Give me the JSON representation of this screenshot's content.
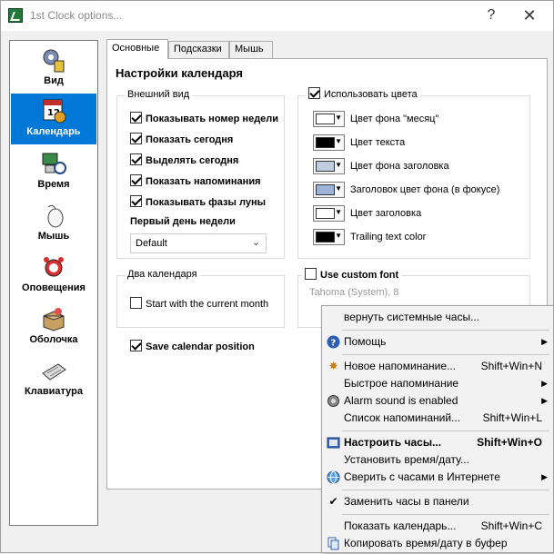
{
  "window": {
    "title": "1st Clock options...",
    "help_glyph": "?",
    "close_glyph": "✕"
  },
  "sidebar": {
    "items": [
      {
        "label": "Вид",
        "icon": "gear-icon"
      },
      {
        "label": "Календарь",
        "icon": "calendar-icon"
      },
      {
        "label": "Время",
        "icon": "computer-clock-icon"
      },
      {
        "label": "Мышь",
        "icon": "mouse-icon"
      },
      {
        "label": "Оповещения",
        "icon": "alarm-clock-icon"
      },
      {
        "label": "Оболочка",
        "icon": "box-icon"
      },
      {
        "label": "Клавиатура",
        "icon": "keyboard-icon"
      }
    ],
    "active_index": 1
  },
  "tabs": [
    {
      "label": "Основные",
      "active": true
    },
    {
      "label": "Подсказки",
      "active": false
    },
    {
      "label": "Мышь",
      "active": false
    }
  ],
  "panel": {
    "title": "Настройки календаря",
    "appearance": {
      "legend": "Внешний вид",
      "checkboxes": [
        {
          "label": "Показывать номер недели",
          "checked": true
        },
        {
          "label": "Показать сегодня",
          "checked": true
        },
        {
          "label": "Выделять сегодня",
          "checked": true
        },
        {
          "label": "Показать напоминания",
          "checked": true
        },
        {
          "label": "Показывать фазы луны",
          "checked": true
        }
      ],
      "first_day_label": "Первый день недели",
      "first_day_value": "Default"
    },
    "colors": {
      "use_colors_label": "Использовать цвета",
      "use_colors_checked": true,
      "rows": [
        {
          "label": "Цвет фона \"месяц\"",
          "color": "#ffffff"
        },
        {
          "label": "Цвет текста",
          "color": "#000000"
        },
        {
          "label": "Цвет фона заголовка",
          "color": "#c0cce0"
        },
        {
          "label": "Заголовок цвет фона (в фокусе)",
          "color": "#9db4d8"
        },
        {
          "label": "Цвет заголовка",
          "color": "#ffffff"
        },
        {
          "label": "Trailing text color",
          "color": "#000000"
        }
      ]
    },
    "two_calendars": {
      "legend": "Два календаря",
      "start_current_label": "Start with the current month",
      "start_current_checked": false
    },
    "custom_font": {
      "label": "Use custom font",
      "checked": false,
      "font_name": "Tahoma (System), 8"
    },
    "save_position": {
      "label": "Save calendar position",
      "checked": true
    }
  },
  "context_menu": {
    "items": [
      {
        "type": "item",
        "label": "вернуть системные часы...",
        "shortcut": "",
        "icon": "",
        "bold": false,
        "submenu": false
      },
      {
        "type": "sep"
      },
      {
        "type": "item",
        "label": "Помощь",
        "shortcut": "",
        "icon": "help-icon",
        "bold": false,
        "submenu": true
      },
      {
        "type": "sep"
      },
      {
        "type": "item",
        "label": "Новое напоминание...",
        "shortcut": "Shift+Win+N",
        "icon": "sparkle-icon",
        "bold": false,
        "submenu": false
      },
      {
        "type": "item",
        "label": "Быстрое напоминание",
        "shortcut": "",
        "icon": "",
        "bold": false,
        "submenu": true
      },
      {
        "type": "item",
        "label": "Alarm sound is enabled",
        "shortcut": "",
        "icon": "speaker-icon",
        "bold": false,
        "submenu": true
      },
      {
        "type": "item",
        "label": "Список напоминаний...",
        "shortcut": "Shift+Win+L",
        "icon": "",
        "bold": false,
        "submenu": false
      },
      {
        "type": "sep"
      },
      {
        "type": "item",
        "label": "Настроить часы...",
        "shortcut": "Shift+Win+O",
        "icon": "settings-app-icon",
        "bold": true,
        "submenu": false
      },
      {
        "type": "item",
        "label": "Установить время/дату...",
        "shortcut": "",
        "icon": "",
        "bold": false,
        "submenu": false
      },
      {
        "type": "item",
        "label": "Сверить с часами в Интернете",
        "shortcut": "",
        "icon": "globe-icon",
        "bold": false,
        "submenu": true
      },
      {
        "type": "sep"
      },
      {
        "type": "item",
        "label": "Заменить часы в панели",
        "shortcut": "",
        "icon": "checkmark-icon",
        "bold": false,
        "submenu": false
      },
      {
        "type": "sep"
      },
      {
        "type": "item",
        "label": "Показать календарь...",
        "shortcut": "Shift+Win+C",
        "icon": "",
        "bold": false,
        "submenu": false
      },
      {
        "type": "item",
        "label": "Копировать время/дату в буфер",
        "shortcut": "",
        "icon": "copy-icon",
        "bold": false,
        "submenu": false
      }
    ]
  },
  "colors": {
    "accent": "#0078d7",
    "menu_bg": "#f2f2f2"
  }
}
